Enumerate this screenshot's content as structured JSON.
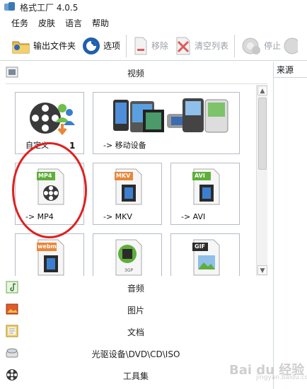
{
  "window": {
    "title": "格式工厂 4.0.5"
  },
  "menubar": {
    "items": [
      "任务",
      "皮肤",
      "语言",
      "帮助"
    ]
  },
  "toolbar": {
    "output_folder": "输出文件夹",
    "options": "选项",
    "remove": "移除",
    "clear_list": "清空列表",
    "stop": "停止"
  },
  "categories": {
    "video": "视频",
    "audio": "音频",
    "picture": "图片",
    "document": "文档",
    "optical": "光驱设备\\DVD\\CD\\ISO",
    "tools": "工具集"
  },
  "tiles": {
    "custom_label": "自定义",
    "custom_number": "1",
    "mobile_label": "-> 移动设备",
    "mp4_label": "-> MP4",
    "mp4_badge": "MP4",
    "mkv_label": "-> MKV",
    "mkv_badge": "MKV",
    "avi_label": "-> AVI",
    "avi_badge": "AVI",
    "webm_badge": "webm",
    "gp_badge": "3GP",
    "gif_badge": "GIF"
  },
  "right_pane": {
    "header": "来源"
  },
  "watermark": {
    "text": "Bai du 经验",
    "sub": "jingyan.baidu.com"
  },
  "colors": {
    "highlight_circle": "#e02020",
    "badge_green": "#5fae3a",
    "badge_orange": "#e8873a"
  }
}
